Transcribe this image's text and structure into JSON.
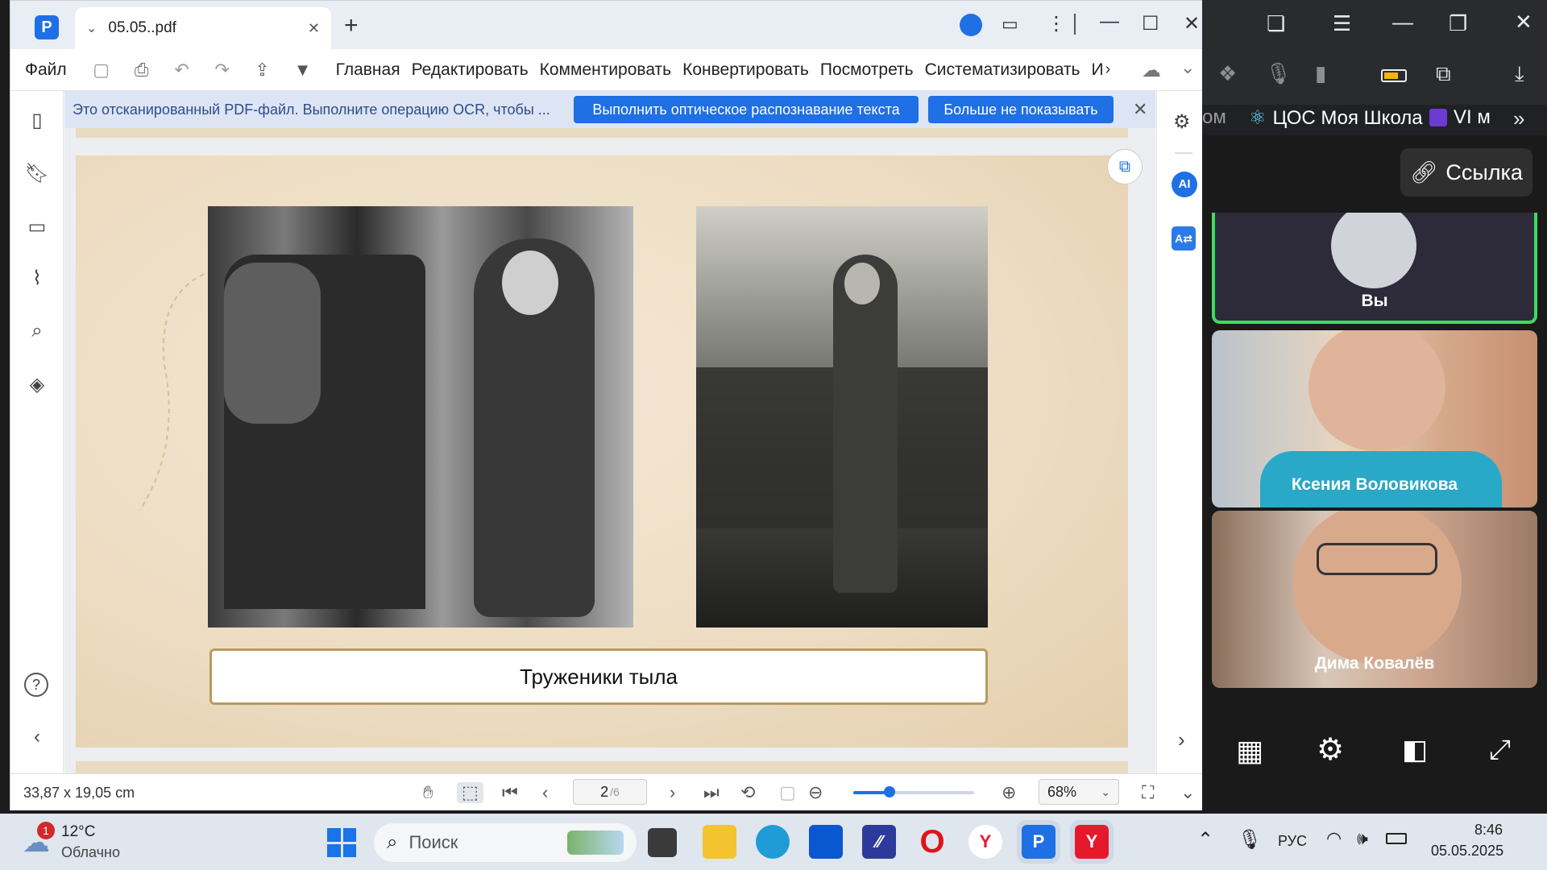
{
  "pdf": {
    "tab_title": "05.05..pdf",
    "new_tab": "+",
    "menu": {
      "file": "Файл",
      "items": [
        "Главная",
        "Редактировать",
        "Комментировать",
        "Конвертировать",
        "Посмотреть",
        "Систематизировать",
        "И"
      ]
    },
    "ocr_banner": {
      "message": "Это отсканированный PDF-файл. Выполните операцию OCR, чтобы ...",
      "ocr_button": "Выполнить оптическое распознавание текста",
      "hide_button": "Больше не показывать"
    },
    "slide": {
      "caption": "Труженики тыла"
    },
    "status": {
      "dimensions": "33,87 x 19,05 cm",
      "page_current": "2",
      "page_total": "/6",
      "zoom": "68%",
      "zoom_level": 0.3
    },
    "right_tools": {
      "ai_label": "AI"
    }
  },
  "browser": {
    "bookmarks": [
      "ЦОС Моя Школа",
      "VI м"
    ],
    "bookmark_partial": "ом",
    "link_button": "Ссылка",
    "participants": [
      {
        "name": "Вы"
      },
      {
        "name": "Ксения Воловикова"
      },
      {
        "name": "Дима Ковалёв"
      }
    ]
  },
  "taskbar": {
    "weather_temp": "12°C",
    "weather_desc": "Облачно",
    "weather_badge": "1",
    "search_placeholder": "Поиск",
    "lang": "РУС",
    "time": "8:46",
    "date": "05.05.2025"
  },
  "colors": {
    "accent_blue": "#1f6fe5",
    "meet_active_border": "#3ddc5f",
    "slide_caption_border": "#b99a5e"
  }
}
